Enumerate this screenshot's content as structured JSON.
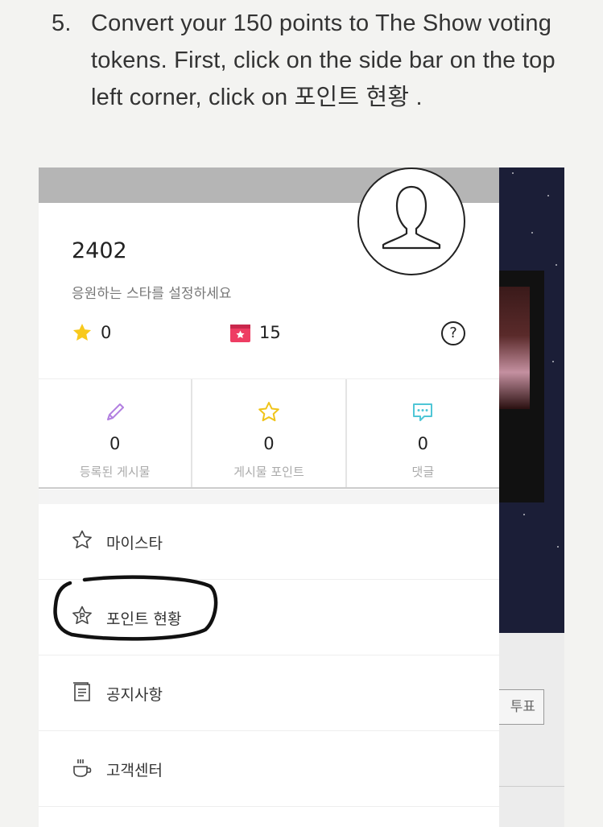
{
  "instruction": {
    "number": "5.",
    "text": "Convert your 150 points to The Show voting tokens. First, click on the side bar on the top left corner, click on 포인트 현황 ."
  },
  "profile": {
    "username": "2402",
    "subtitle": "응원하는 스타를 설정하세요",
    "star_count": "0",
    "ticket_count": "15",
    "help_symbol": "?"
  },
  "stats": [
    {
      "icon": "pencil-icon",
      "value": "0",
      "label": "등록된 게시물"
    },
    {
      "icon": "star-outline-icon",
      "value": "0",
      "label": "게시물 포인트"
    },
    {
      "icon": "comment-bubble-icon",
      "value": "0",
      "label": "댓글"
    }
  ],
  "menu": [
    {
      "icon": "star-outline-icon",
      "label": "마이스타"
    },
    {
      "icon": "point-star-icon",
      "label": "포인트 현황"
    },
    {
      "icon": "notice-document-icon",
      "label": "공지사항"
    },
    {
      "icon": "coffee-cup-icon",
      "label": "고객센터"
    }
  ],
  "background": {
    "vote_button_label": "투표"
  },
  "colors": {
    "star_yellow": "#f8c91c",
    "ticket_pink": "#ee3d63",
    "pencil_purple": "#b27fe0",
    "star_yellow_outline": "#f0c419",
    "comment_teal": "#4fc6d6",
    "overlay_gray": "#b5b5b5",
    "night_bg": "#1b1e37"
  }
}
